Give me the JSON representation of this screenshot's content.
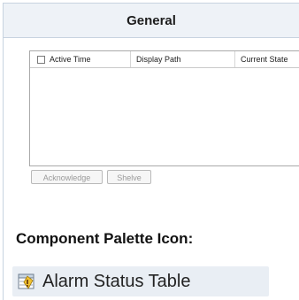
{
  "header": {
    "title": "General"
  },
  "table": {
    "columns": [
      "Active Time",
      "Display Path",
      "Current State"
    ]
  },
  "buttons": {
    "acknowledge": "Acknowledge",
    "shelve": "Shelve"
  },
  "palette": {
    "section_title": "Component Palette Icon:",
    "component_label": "Alarm Status Table",
    "icon": "alarm-status-table-icon"
  }
}
